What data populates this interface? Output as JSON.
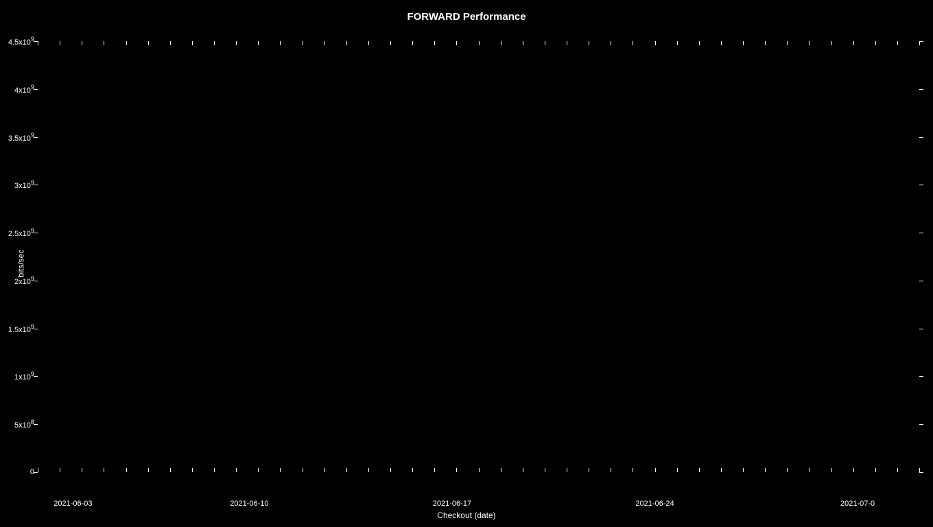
{
  "chart": {
    "title": "FORWARD Performance",
    "y_axis_label": "bits/sec",
    "x_axis_title": "Checkout (date)",
    "y_ticks": [
      {
        "label": "4.5x10",
        "exp": "9",
        "pct": 100
      },
      {
        "label": "4x10",
        "exp": "9",
        "pct": 88.89
      },
      {
        "label": "3.5x10",
        "exp": "9",
        "pct": 77.78
      },
      {
        "label": "3x10",
        "exp": "9",
        "pct": 66.67
      },
      {
        "label": "2.5x10",
        "exp": "9",
        "pct": 55.56
      },
      {
        "label": "2x10",
        "exp": "9",
        "pct": 44.44
      },
      {
        "label": "1.5x10",
        "exp": "9",
        "pct": 33.33
      },
      {
        "label": "1x10",
        "exp": "9",
        "pct": 22.22
      },
      {
        "label": "5x10",
        "exp": "8",
        "pct": 11.11
      },
      {
        "label": "0",
        "exp": "",
        "pct": 0
      }
    ],
    "x_labels": [
      {
        "text": "2021-06-03",
        "pct": 4
      },
      {
        "text": "2021-06-10",
        "pct": 24
      },
      {
        "text": "2021-06-17",
        "pct": 47
      },
      {
        "text": "2021-06-24",
        "pct": 70
      },
      {
        "text": "2021-07-0",
        "pct": 93
      }
    ],
    "num_top_ticks": 40,
    "num_bottom_ticks": 40
  }
}
